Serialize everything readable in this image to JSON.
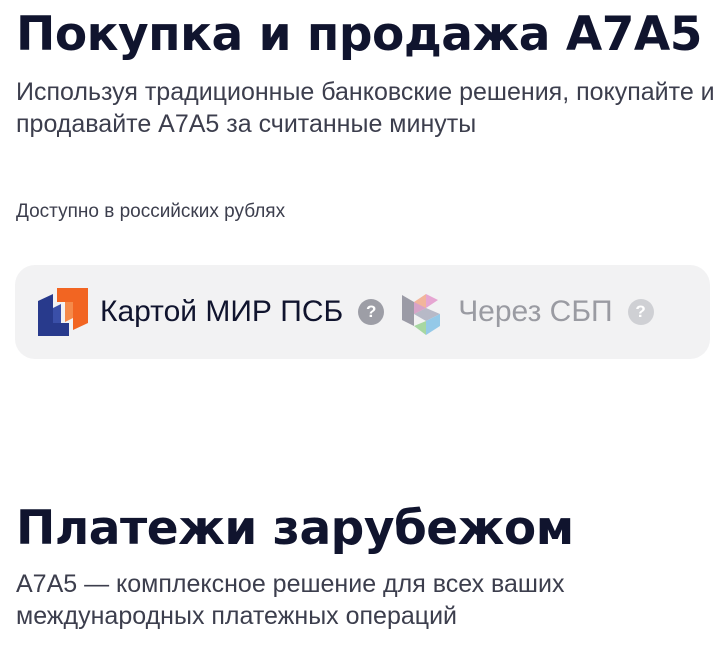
{
  "buy_section": {
    "title": "Покупка и продажа A7A5",
    "description": "Используя традиционные банковские решения, покупайте и продавайте A7A5 за считанные минуты",
    "availability": "Доступно в российских рублях",
    "methods": [
      {
        "label": "Картой МИР ПСБ",
        "icon": "psb-logo-icon",
        "help": "?",
        "state": "active"
      },
      {
        "label": "Через СБП",
        "icon": "sbp-logo-icon",
        "help": "?",
        "state": "inactive"
      }
    ]
  },
  "intl_section": {
    "title": "Платежи зарубежом",
    "description": "A7A5 — комплексное решение для всех ваших международных платежных операций"
  },
  "colors": {
    "heading": "#10142e",
    "body_text": "#3c3e4d",
    "muted_text": "#9a9ba2",
    "panel_bg": "#f2f2f3",
    "psb_blue": "#283a8c",
    "psb_orange": "#f26522"
  }
}
